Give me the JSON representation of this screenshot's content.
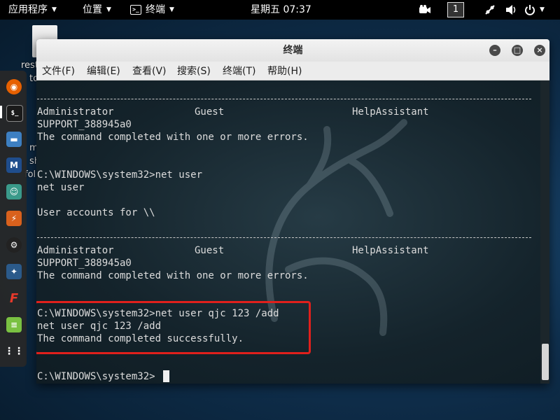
{
  "topbar": {
    "applications": "应用程序",
    "places": "位置",
    "terminal_app": "终端",
    "clock": "星期五 07:37",
    "workspace": "1"
  },
  "desktop": {
    "file_labels": [
      "rest",
      "tools.sh",
      "mount-",
      "shared-",
      "fol"
    ]
  },
  "window": {
    "title": "终端",
    "menus": [
      "文件(F)",
      "编辑(E)",
      "查看(V)",
      "搜索(S)",
      "终端(T)",
      "帮助(H)"
    ]
  },
  "terminal": {
    "account_row_1": [
      "Administrator",
      "Guest",
      "HelpAssistant"
    ],
    "support_1": "SUPPORT_388945a0",
    "error_1": "The command completed with one or more errors.",
    "prompt_1": "C:\\WINDOWS\\system32>net user",
    "echo_1": "net user",
    "accounts_for": "User accounts for \\\\",
    "account_row_2": [
      "Administrator",
      "Guest",
      "HelpAssistant"
    ],
    "support_2": "SUPPORT_388945a0",
    "error_2": "The command completed with one or more errors.",
    "prompt_2": "C:\\WINDOWS\\system32>net user qjc 123 /add",
    "echo_2": "net user qjc 123 /add",
    "success": "The command completed successfully.",
    "prompt_current": "C:\\WINDOWS\\system32>"
  },
  "icons": {
    "dock": [
      "firefox-icon",
      "terminal-icon",
      "files-icon",
      "metasploit-icon",
      "armitage-icon",
      "burpsuite-icon",
      "maltego-icon",
      "beef-icon",
      "faraday-icon",
      "leafpad-icon",
      "show-apps-icon"
    ],
    "tray": [
      "video-icon",
      "network-icon",
      "sound-icon",
      "power-icon"
    ]
  },
  "colors": {
    "highlight": "#e0201c",
    "terminal_bg": "#14232b",
    "terminal_text": "#dcdcdc"
  }
}
